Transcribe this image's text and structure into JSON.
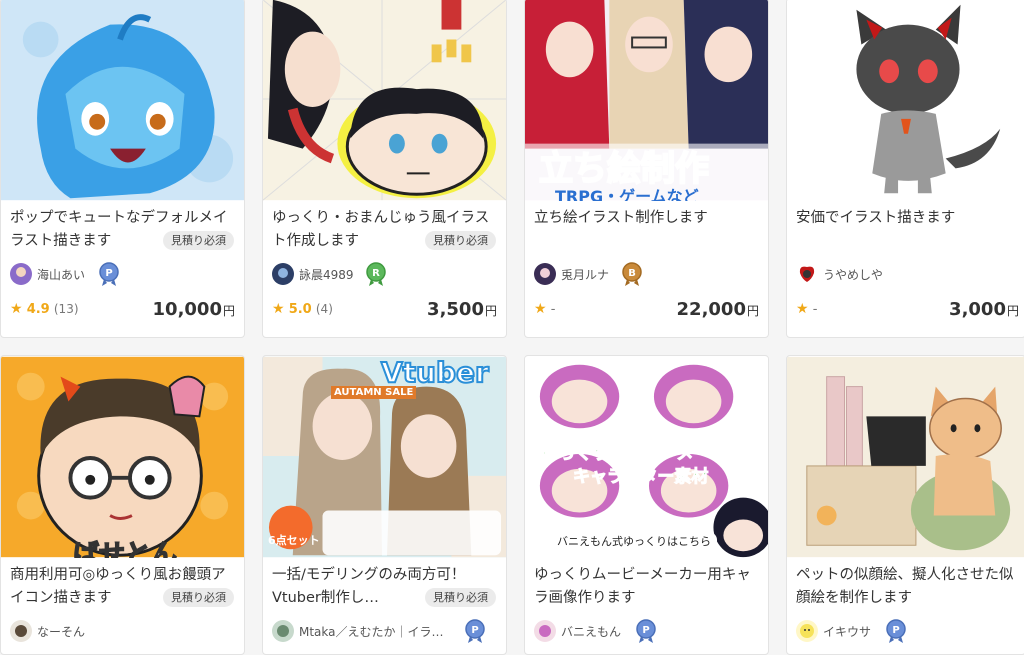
{
  "cards": [
    {
      "title": "ポップでキュートなデフォルメイラスト描きます",
      "estimate_badge": "見積り必須",
      "seller": "海山あい",
      "rank": "P",
      "rank_color": "#6a8fd8",
      "rating": "4.9",
      "rating_count": "(13)",
      "price": "10,000",
      "thumb_icon": "blue-mermaid-illustration"
    },
    {
      "title": "ゆっくり・おまんじゅう風イラスト作成します",
      "estimate_badge": "見積り必須",
      "seller": "詠晨4989",
      "rank": "R",
      "rank_color": "#5cb85c",
      "rating": "5.0",
      "rating_count": "(4)",
      "price": "3,500",
      "thumb_icon": "yukkuri-manju-illustration"
    },
    {
      "title": "立ち絵イラスト制作します",
      "estimate_badge": "",
      "seller": "兎月ルナ",
      "rank": "B",
      "rank_color": "#c98a3a",
      "rating": "",
      "rating_count": "",
      "rating_dash": "-",
      "price": "22,000",
      "thumb_icon": "standing-illustration-banner",
      "thumb_text": "立ち絵制作",
      "thumb_subtext": "TRPG・ゲームなど"
    },
    {
      "title": "安価でイラスト描きます",
      "estimate_badge": "",
      "seller": "うやめしや",
      "rank": "",
      "rank_color": "",
      "rating": "",
      "rating_count": "",
      "rating_dash": "-",
      "price": "3,000",
      "thumb_icon": "gray-cat-illustration"
    },
    {
      "title": "商用利用可◎ゆっくり風お饅頭アイコン描きます",
      "estimate_badge": "見積り必須",
      "seller": "なーそん",
      "rank": "",
      "rank_color": "",
      "price": "",
      "thumb_icon": "glasses-man-icon-illustration",
      "thumb_text": "ばせとん"
    },
    {
      "title": "一括/モデリングのみ両方可！Vtuber制作し…",
      "estimate_badge": "見積り必須",
      "seller": "Mtaka／えむたか｜イラ…",
      "rank": "P",
      "rank_color": "#6a8fd8",
      "price": "",
      "thumb_icon": "vtuber-package-banner",
      "thumb_text": "Vtuber",
      "thumb_subtext": "AUTAMN SALE",
      "thumb_note": "6点セット"
    },
    {
      "title": "ゆっくりムービーメーカー用キャラ画像作ります",
      "estimate_badge": "",
      "seller": "バニえもん",
      "rank": "P",
      "rank_color": "#6a8fd8",
      "price": "",
      "thumb_icon": "yukkuri-movie-maker-banner",
      "thumb_text": "ゆっくりムービーメーカー",
      "thumb_subtext": "キャラクター素材",
      "thumb_note": "バニえもん式ゆっくりはこちら"
    },
    {
      "title": "ペットの似顔絵、擬人化させた似顔絵を制作します",
      "estimate_badge": "",
      "seller": "イキウサ",
      "rank": "P",
      "rank_color": "#6a8fd8",
      "price": "",
      "thumb_icon": "cat-sewing-illustration"
    }
  ],
  "currency": "円",
  "star_glyph": "★"
}
